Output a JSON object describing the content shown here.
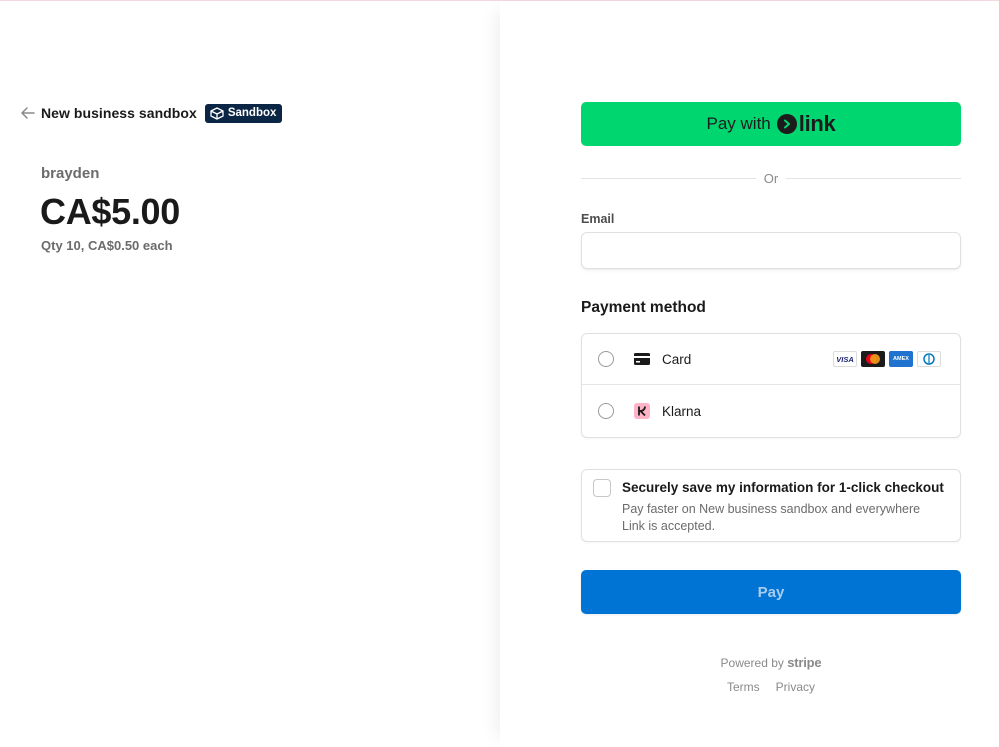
{
  "merchant": {
    "name": "New business sandbox",
    "badge": "Sandbox"
  },
  "product": {
    "name": "brayden",
    "price": "CA$5.00",
    "quantity_note": "Qty 10, CA$0.50 each"
  },
  "link_button": {
    "prefix": "Pay with",
    "brand": "link",
    "color": "#00d66f"
  },
  "divider": {
    "text": "Or"
  },
  "email": {
    "label": "Email",
    "value": "",
    "placeholder": ""
  },
  "payment_method": {
    "title": "Payment method",
    "options": [
      {
        "label": "Card",
        "icon": "card-icon",
        "selected": false,
        "brands": [
          "VISA",
          "mastercard",
          "AMEX",
          "diners"
        ]
      },
      {
        "label": "Klarna",
        "icon": "klarna-icon",
        "selected": false
      }
    ]
  },
  "save_info": {
    "checked": false,
    "title": "Securely save my information for 1-click checkout",
    "description": "Pay faster on New business sandbox and everywhere Link is accepted."
  },
  "pay_button": {
    "label": "Pay",
    "color": "#0074d4"
  },
  "footer": {
    "powered_by": "Powered by",
    "brand": "stripe",
    "links": [
      "Terms",
      "Privacy"
    ]
  }
}
